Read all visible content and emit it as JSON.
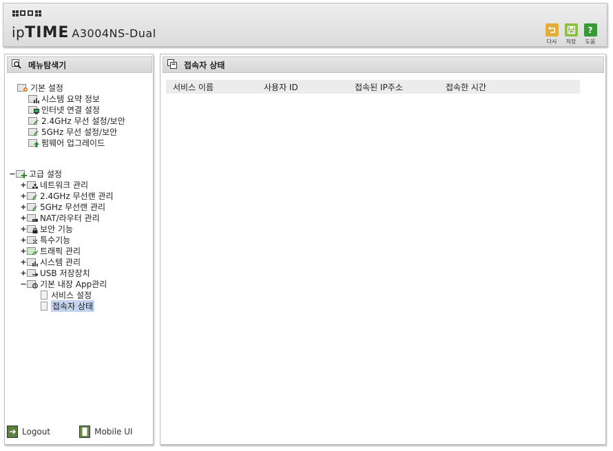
{
  "header": {
    "brand_prefix": "ip",
    "brand_time": "TIME",
    "model": "A3004NS-Dual",
    "buttons": [
      {
        "label": "다시",
        "icon": "undo-icon",
        "color": "#e7b042"
      },
      {
        "label": "저장",
        "icon": "save-icon",
        "color": "#8cc043"
      },
      {
        "label": "도움",
        "icon": "help-icon",
        "color": "#3a9b3a",
        "glyph": "?"
      }
    ]
  },
  "sidebar": {
    "title": "메뉴탐색기",
    "basic": {
      "label": "기본 설정",
      "items": [
        "시스템 요약 정보",
        "인터넷 연결 설정",
        "2.4GHz 무선 설정/보안",
        "5GHz 무선 설정/보안",
        "펌웨어 업그레이드"
      ]
    },
    "advanced": {
      "label": "고급 설정",
      "expander": "−",
      "items": [
        {
          "label": "네트워크 관리",
          "exp": "+"
        },
        {
          "label": "2.4GHz 무선랜 관리",
          "exp": "+"
        },
        {
          "label": "5GHz 무선랜 관리",
          "exp": "+"
        },
        {
          "label": "NAT/라우터 관리",
          "exp": "+"
        },
        {
          "label": "보안 기능",
          "exp": "+"
        },
        {
          "label": "특수기능",
          "exp": "+"
        },
        {
          "label": "트래픽 관리",
          "exp": "+"
        },
        {
          "label": "시스템 관리",
          "exp": "+"
        },
        {
          "label": "USB 저장장치",
          "exp": "+"
        },
        {
          "label": "기본 내장 App관리",
          "exp": "−"
        }
      ],
      "app_children": [
        "서비스 설정",
        "접속자 상태"
      ]
    },
    "footer": {
      "logout": "Logout",
      "mobile": "Mobile UI"
    }
  },
  "main": {
    "title": "접속자 상태",
    "columns": [
      "서비스 이름",
      "사용자 ID",
      "접속된 IP주소",
      "접속한 시간"
    ]
  }
}
